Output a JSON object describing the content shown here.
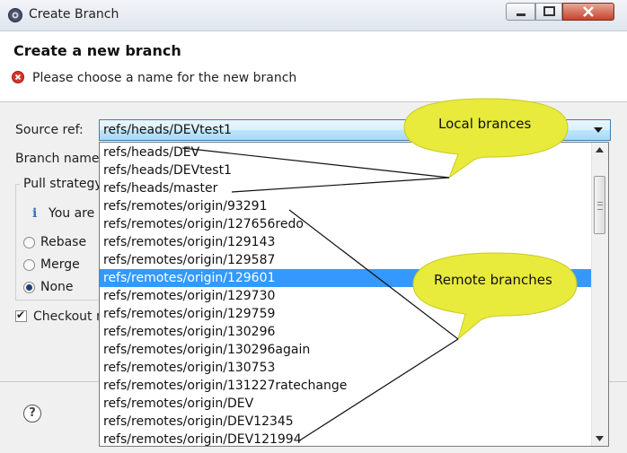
{
  "window": {
    "title": "Create Branch",
    "icon": "gear-icon"
  },
  "header": {
    "title": "Create a new branch",
    "message": "Please choose a name for the new branch",
    "message_icon": "error-icon"
  },
  "form": {
    "source_ref_label": "Source ref:",
    "source_ref_value": "refs/heads/DEVtest1",
    "branch_name_label": "Branch name:",
    "pull_strategy": {
      "title": "Pull strategy",
      "info_text": "You are c",
      "options": [
        {
          "label": "Rebase",
          "checked": false
        },
        {
          "label": "Merge",
          "checked": false
        },
        {
          "label": "None",
          "checked": true
        }
      ]
    },
    "checkout_label": "Checkout n",
    "checkout_checked": true
  },
  "dropdown": {
    "items": [
      "refs/heads/DEV",
      "refs/heads/DEVtest1",
      "refs/heads/master",
      "refs/remotes/origin/93291",
      "refs/remotes/origin/127656redo",
      "refs/remotes/origin/129143",
      "refs/remotes/origin/129587",
      "refs/remotes/origin/129601",
      "refs/remotes/origin/129730",
      "refs/remotes/origin/129759",
      "refs/remotes/origin/130296",
      "refs/remotes/origin/130296again",
      "refs/remotes/origin/130753",
      "refs/remotes/origin/131227ratechange",
      "refs/remotes/origin/DEV",
      "refs/remotes/origin/DEV12345",
      "refs/remotes/origin/DEV121994"
    ],
    "selected": "refs/remotes/origin/129601"
  },
  "annotations": {
    "local": "Local brances",
    "remote": "Remote branches",
    "bubble_color": "#e8ea3c"
  },
  "colors": {
    "selection": "#3399ff",
    "combo_border": "#3c7fb1"
  }
}
